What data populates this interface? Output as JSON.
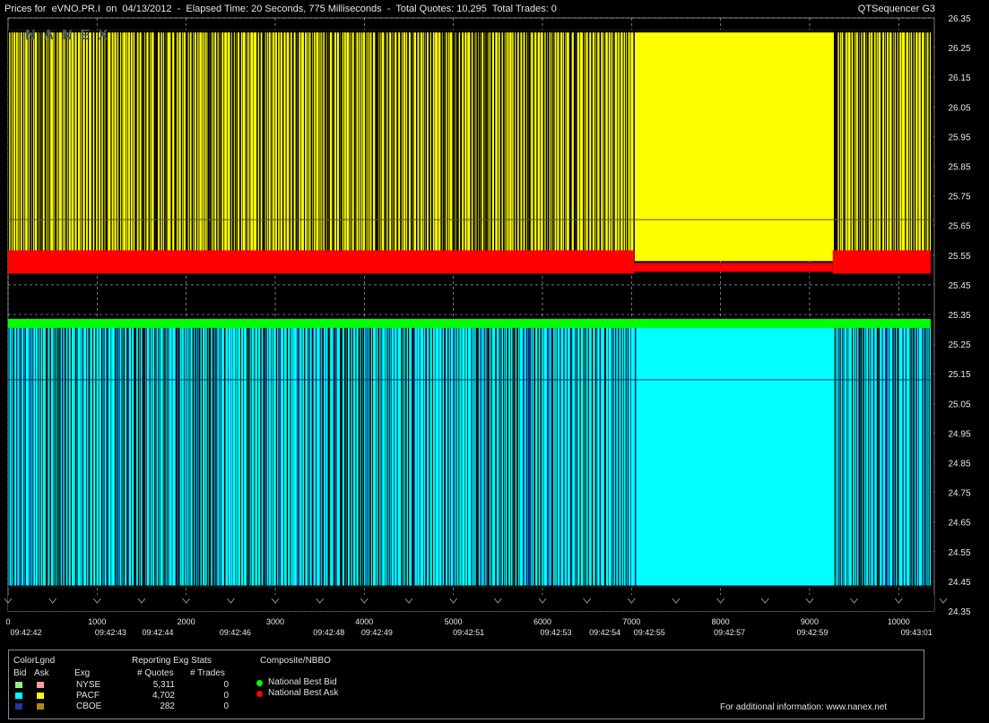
{
  "header": {
    "title": "Prices for  eVNO.PR.I  on  04/13/2012  -  Elapsed Time: 20 Seconds, 775 Milliseconds  -  Total Quotes: 10,295  Total Trades: 0",
    "product": "QTSequencer G3",
    "watermark": "NANEX"
  },
  "chart_data": {
    "type": "line",
    "title": "Prices for  eVNO.PR.I  on  04/13/2012",
    "ylim": [
      24.35,
      26.35
    ],
    "y_ticks": [
      "26.35",
      "26.25",
      "26.15",
      "26.05",
      "25.95",
      "25.85",
      "25.75",
      "25.65",
      "25.55",
      "25.45",
      "25.35",
      "25.25",
      "25.15",
      "25.05",
      "24.95",
      "24.85",
      "24.75",
      "24.65",
      "24.55",
      "24.45",
      "24.35"
    ],
    "xlim": [
      0,
      10295
    ],
    "x_ticks": [
      "0",
      "1000",
      "2000",
      "3000",
      "4000",
      "5000",
      "6000",
      "7000",
      "8000",
      "9000",
      "10000"
    ],
    "time_labels": [
      {
        "x": 0,
        "t": "09:42:42"
      },
      {
        "x": 950,
        "t": "09:42:43"
      },
      {
        "x": 1480,
        "t": "09:42:44"
      },
      {
        "x": 2350,
        "t": "09:42:46"
      },
      {
        "x": 3400,
        "t": "09:42:48"
      },
      {
        "x": 3940,
        "t": "09:42:49"
      },
      {
        "x": 4970,
        "t": "09:42:51"
      },
      {
        "x": 5950,
        "t": "09:42:53"
      },
      {
        "x": 6500,
        "t": "09:42:54"
      },
      {
        "x": 7000,
        "t": "09:42:55"
      },
      {
        "x": 7900,
        "t": "09:42:57"
      },
      {
        "x": 8830,
        "t": "09:42:59"
      },
      {
        "x": 10000,
        "t": "09:43:01"
      }
    ],
    "series": [
      {
        "name": "National Best Bid",
        "color": "#00ff00",
        "value": 25.32
      },
      {
        "name": "National Best Ask",
        "color": "#ff0000",
        "value": 25.53
      }
    ],
    "exchange_quotes": {
      "ask_high": 26.31,
      "ask_low": 25.53,
      "bid_high": 25.32,
      "bid_low": 24.43,
      "dense_region": [
        7030,
        9260
      ]
    },
    "ref_lines": [
      25.67,
      25.13
    ],
    "grid": true
  },
  "legend": {
    "color_legend_title": "ColorLgnd",
    "bid_label": "Bid",
    "ask_label": "Ask",
    "exch_header": "Exg",
    "stats_title": "Reporting Exg Stats",
    "quotes_header": "# Quotes",
    "trades_header": "# Trades",
    "composite_title": "Composite/NBBO",
    "exchanges": [
      {
        "name": "NYSE",
        "quotes": "5,311",
        "trades": "0",
        "bid_color": "#90ee90",
        "ask_color": "#f4a0a0"
      },
      {
        "name": "PACF",
        "quotes": "4,702",
        "trades": "0",
        "bid_color": "#00ffff",
        "ask_color": "#ffff00"
      },
      {
        "name": "CBOE",
        "quotes": "282",
        "trades": "0",
        "bid_color": "#1a3aa0",
        "ask_color": "#b8860b"
      }
    ],
    "composite": [
      {
        "label": "National Best Bid",
        "color": "#00ff00"
      },
      {
        "label": "National Best Ask",
        "color": "#ff0000"
      }
    ],
    "footer": "For additional information: www.nanex.net"
  }
}
